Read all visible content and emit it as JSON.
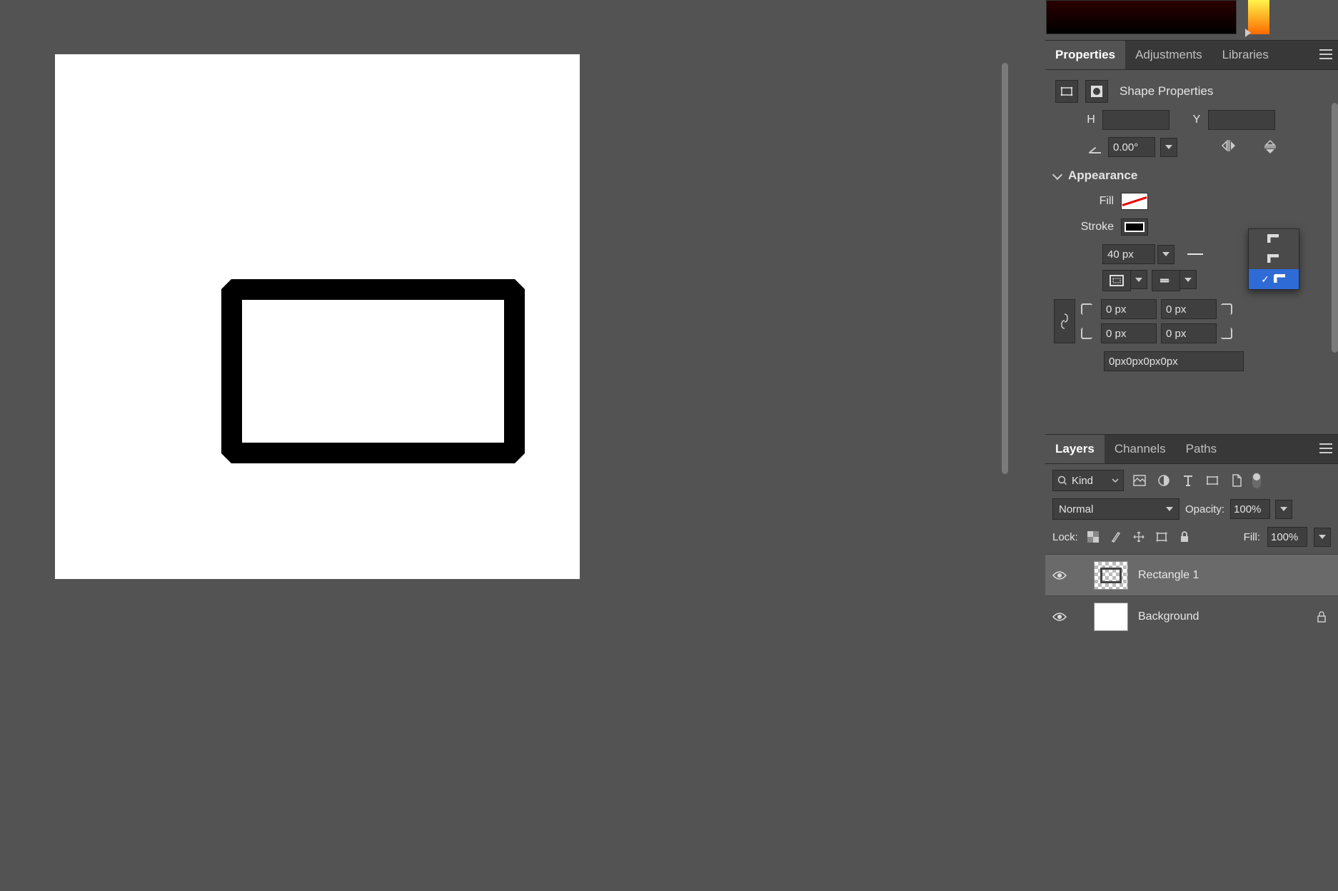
{
  "panels": {
    "properties_tabs": [
      "Properties",
      "Adjustments",
      "Libraries"
    ],
    "properties_active": "Properties",
    "layers_tabs": [
      "Layers",
      "Channels",
      "Paths"
    ],
    "layers_active": "Layers"
  },
  "shape_props": {
    "title": "Shape Properties",
    "H_label": "H",
    "H_value": "",
    "Y_label": "Y",
    "Y_value": "",
    "rotation": "0.00°"
  },
  "appearance": {
    "header": "Appearance",
    "fill_label": "Fill",
    "stroke_label": "Stroke",
    "stroke_width": "40 px",
    "corner_tl": "0 px",
    "corner_tr": "0 px",
    "corner_bl": "0 px",
    "corner_br": "0 px",
    "combined": "0px0px0px0px"
  },
  "layers": {
    "kind_label": "Kind",
    "blend_mode": "Normal",
    "opacity_label": "Opacity:",
    "opacity_value": "100%",
    "lock_label": "Lock:",
    "fill_label": "Fill:",
    "fill_value": "100%",
    "items": [
      {
        "name": "Rectangle 1",
        "selected": true,
        "locked": false
      },
      {
        "name": "Background",
        "selected": false,
        "locked": true
      }
    ]
  }
}
